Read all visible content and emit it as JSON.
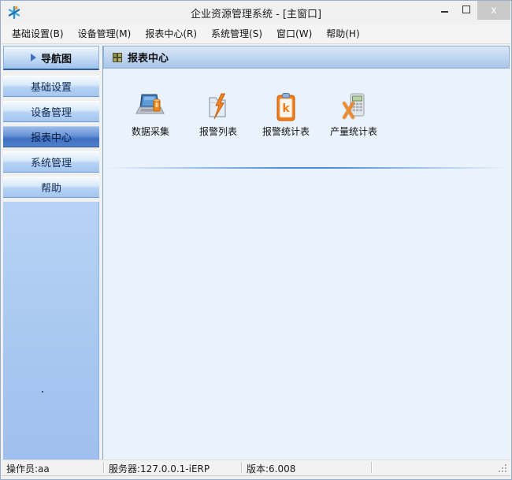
{
  "window": {
    "title": "企业资源管理系统 - [主窗口]",
    "controls": {
      "close": "x"
    }
  },
  "menu": {
    "items": [
      {
        "label": "基础设置(B)"
      },
      {
        "label": "设备管理(M)"
      },
      {
        "label": "报表中心(R)"
      },
      {
        "label": "系统管理(S)"
      },
      {
        "label": "窗口(W)"
      },
      {
        "label": "帮助(H)"
      }
    ]
  },
  "sidebar": {
    "nav_header": "导航图",
    "items": [
      {
        "label": "基础设置",
        "active": false
      },
      {
        "label": "设备管理",
        "active": false
      },
      {
        "label": "报表中心",
        "active": true
      },
      {
        "label": "系统管理",
        "active": false
      },
      {
        "label": "帮助",
        "active": false
      }
    ]
  },
  "main": {
    "header_title": "报表中心",
    "shortcuts": [
      {
        "label": "数据采集",
        "icon": "laptop-data-icon"
      },
      {
        "label": "报警列表",
        "icon": "alarm-list-icon"
      },
      {
        "label": "报警统计表",
        "icon": "alarm-stats-icon"
      },
      {
        "label": "产量统计表",
        "icon": "production-stats-icon"
      }
    ]
  },
  "statusbar": {
    "operator": "操作员:aa",
    "server": "服务器:127.0.0.1-iERP",
    "version": "版本:6.008"
  },
  "colors": {
    "accent_blue": "#4a8ad6",
    "sidebar_active": "#3f70c2",
    "panel_bg": "#eaf2fb",
    "icon_orange": "#ee7d18",
    "header_gradient_bottom": "#a8c6ea"
  }
}
